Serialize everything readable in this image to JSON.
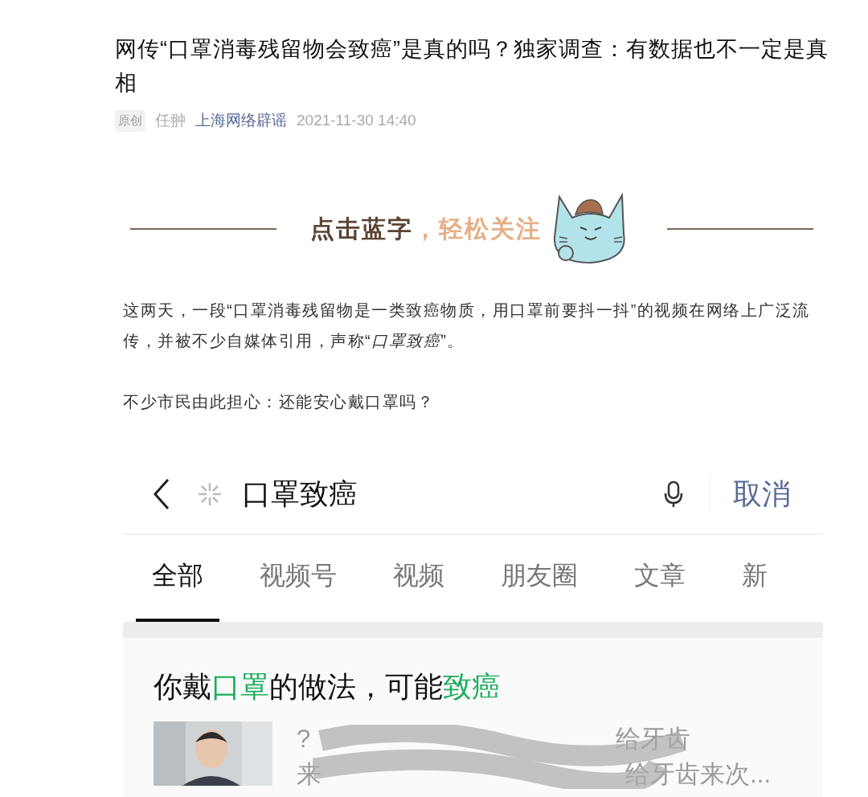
{
  "article": {
    "title": "网传“口罩消毒残留物会致癌”是真的吗？独家调查：有数据也不一定是真相",
    "meta": {
      "badge": "原创",
      "author": "任翀",
      "account": "上海网络辟谣",
      "date": "2021-11-30 14:40"
    },
    "banner": {
      "text_dark": "点击蓝字",
      "text_light": "，轻松关注"
    },
    "paragraphs": [
      "这两天，一段“口罩消毒残留物是一类致癌物质，用口罩前要抖一抖”的视频在网络上广泛流传，并被不少自媒体引用，声称“*口罩致癌*”。",
      "不少市民由此担心：还能安心戴口罩吗？"
    ],
    "screenshot": {
      "query": "口罩致癌",
      "cancel": "取消",
      "tabs": [
        {
          "label": "全部",
          "selected": true
        },
        {
          "label": "视频号",
          "selected": false
        },
        {
          "label": "视频",
          "selected": false
        },
        {
          "label": "朋友圈",
          "selected": false
        },
        {
          "label": "文章",
          "selected": false
        },
        {
          "label": "新",
          "selected": false
        }
      ],
      "result": {
        "title": [
          {
            "text": "你戴",
            "highlight": false
          },
          {
            "text": "口罩",
            "highlight": true
          },
          {
            "text": "的做法，可能",
            "highlight": false
          },
          {
            "text": "致癌",
            "highlight": true
          }
        ],
        "lines": [
          "?",
          "给牙齿",
          "来",
          "给牙齿来次..."
        ]
      }
    }
  }
}
